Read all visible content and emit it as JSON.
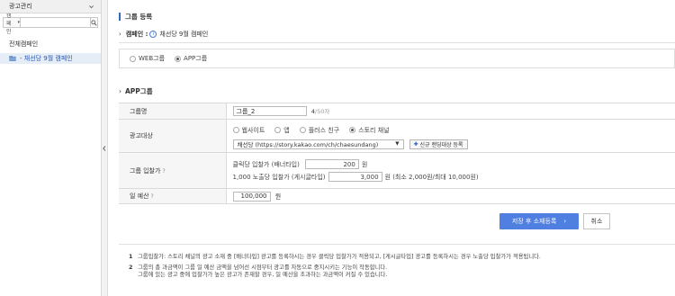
{
  "sidebar": {
    "header_title": "광고관리",
    "search_select": "캠페인",
    "search_placeholder": "",
    "all_campaigns": "전체캠페인",
    "items": [
      {
        "label": "- 채선당 9월 캠페인"
      }
    ]
  },
  "main": {
    "page_title": "그룹 등록",
    "campaign_label": "캠페인 :",
    "campaign_name": "채선당 9월 캠페인",
    "group_type": {
      "options": [
        "WEB그룹",
        "APP그룹"
      ],
      "selected": "APP그룹"
    },
    "section_title": "APP그룹",
    "form": {
      "group_name_label": "그룹명",
      "group_name_value": "그룹_2",
      "group_name_count": "4",
      "group_name_max": "/50자",
      "target_label": "광고대상",
      "target_options": [
        "웹사이트",
        "앱",
        "플러스 친구",
        "스토리 채널"
      ],
      "target_selected": "스토리 채널",
      "channel_select": "채선당 (https://story.kakao.com/ch/chaesundang)",
      "new_target_button": "신규 랜딩대상 등록",
      "bid_label": "그룹 입찰가",
      "click_bid_label": "클릭당 입찰가 (배너타입)",
      "click_bid_value": "200",
      "click_bid_unit": "원",
      "imp_bid_label": "1,000 노출당 입찰가 (게시글타입)",
      "imp_bid_value": "3,000",
      "imp_bid_unit": "원 (최소 2,000원/최대 10,000원)",
      "budget_label": "일 예산",
      "budget_value": "100,000",
      "budget_unit": "원"
    },
    "buttons": {
      "save": "저장 후 소재등록",
      "cancel": "취소"
    },
    "notes": [
      {
        "num": "1",
        "lines": [
          "그룹입찰가: 스토리 채널의 광고 소재 중 [배너타입] 광고를 등록하시는 경우 클릭당 입찰가가 적용되고, [게시글타입] 광고를 등록하시는 경우 노출당 입찰가가 적용됩니다."
        ]
      },
      {
        "num": "2",
        "lines": [
          "그룹의 총 과금액이 그룹 일 예산 금액을 넘어선 시점부터 광고를 자동으로 중지시키는 기능이 작동합니다.",
          "그룹에 있는 광고 중에 입찰가가 높은 광고가 존재할 경우, 일 예산을 초과하는 과금액이 커질 수 있습니다."
        ]
      }
    ]
  },
  "colors": {
    "accent": "#4f7fe0",
    "title_bar": "#3366cc",
    "sidebar_active_bg": "#e5edf7",
    "sidebar_active_text": "#2a58b3"
  }
}
